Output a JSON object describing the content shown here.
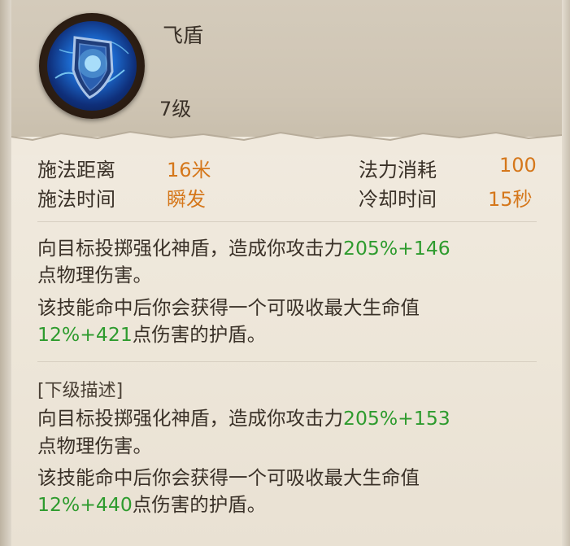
{
  "skill": {
    "name": "飞盾",
    "level": "7级",
    "icon": "shield-icon"
  },
  "stats": {
    "cast_range_label": "施法距离",
    "cast_range_value": "16米",
    "mana_cost_label": "法力消耗",
    "mana_cost_value": "100",
    "cast_time_label": "施法时间",
    "cast_time_value": "瞬发",
    "cooldown_label": "冷却时间",
    "cooldown_value": "15秒"
  },
  "current": {
    "line1": "向目标投掷强化神盾，造成你攻击力",
    "line1_highlight": "205%+146",
    "line2": "点物理伤害。",
    "line3": "该技能命中后你会获得一个可吸收最大生命值",
    "line4_highlight": "12%+421",
    "line4": "点伤害的护盾。"
  },
  "next_level": {
    "title": "[下级描述]",
    "line1": "向目标投掷强化神盾，造成你攻击力",
    "line1_highlight": "205%+153",
    "line2": "点物理伤害。",
    "line3": "该技能命中后你会获得一个可吸收最大生命值",
    "line4_highlight": "12%+440",
    "line4": "点伤害的护盾。"
  },
  "colors": {
    "value_orange": "#d5771b",
    "highlight_green": "#2e9b2e",
    "text": "#3a3128"
  }
}
